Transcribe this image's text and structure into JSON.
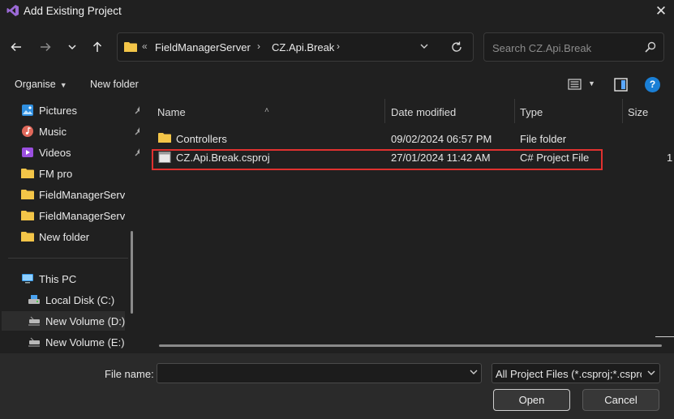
{
  "window": {
    "title": "Add Existing Project"
  },
  "address": {
    "crumbs": [
      "FieldManagerServer",
      "CZ.Api.Break"
    ],
    "overflow": "«"
  },
  "search": {
    "placeholder": "Search CZ.Api.Break"
  },
  "toolbar": {
    "organise_label": "Organise",
    "new_folder_label": "New folder"
  },
  "sidebar": {
    "items": [
      {
        "label": "Pictures",
        "icon": "pictures-icon",
        "pinned": true
      },
      {
        "label": "Music",
        "icon": "music-icon",
        "pinned": true
      },
      {
        "label": "Videos",
        "icon": "videos-icon",
        "pinned": true
      },
      {
        "label": "FM pro",
        "icon": "folder-icon",
        "pinned": false
      },
      {
        "label": "FieldManagerServ",
        "icon": "folder-icon",
        "pinned": false
      },
      {
        "label": "FieldManagerServ",
        "icon": "folder-icon",
        "pinned": false
      },
      {
        "label": "New folder",
        "icon": "folder-icon",
        "pinned": false
      }
    ],
    "this_pc": "This PC",
    "drives": [
      {
        "label": "Local Disk (C:)",
        "icon": "drive-icon"
      },
      {
        "label": "New Volume (D:)",
        "icon": "network-drive-icon",
        "selected": true
      },
      {
        "label": "New Volume (E:)",
        "icon": "network-drive-icon"
      }
    ]
  },
  "filelist": {
    "columns": [
      "Name",
      "Date modified",
      "Type",
      "Size"
    ],
    "rows": [
      {
        "name": "Controllers",
        "date": "09/02/2024 06:57 PM",
        "type": "File folder",
        "size": ""
      },
      {
        "name": "CZ.Api.Break.csproj",
        "date": "27/01/2024 11:42 AM",
        "type": "C# Project File",
        "size": "1"
      }
    ]
  },
  "footer": {
    "file_name_label": "File name:",
    "file_name_value": "",
    "filter": "All Project Files (*.csproj;*.csproj",
    "open_label": "Open",
    "cancel_label": "Cancel"
  },
  "colors": {
    "accent": "#1a7fd6",
    "highlight": "#e0312f",
    "folder": "#f3c548"
  }
}
